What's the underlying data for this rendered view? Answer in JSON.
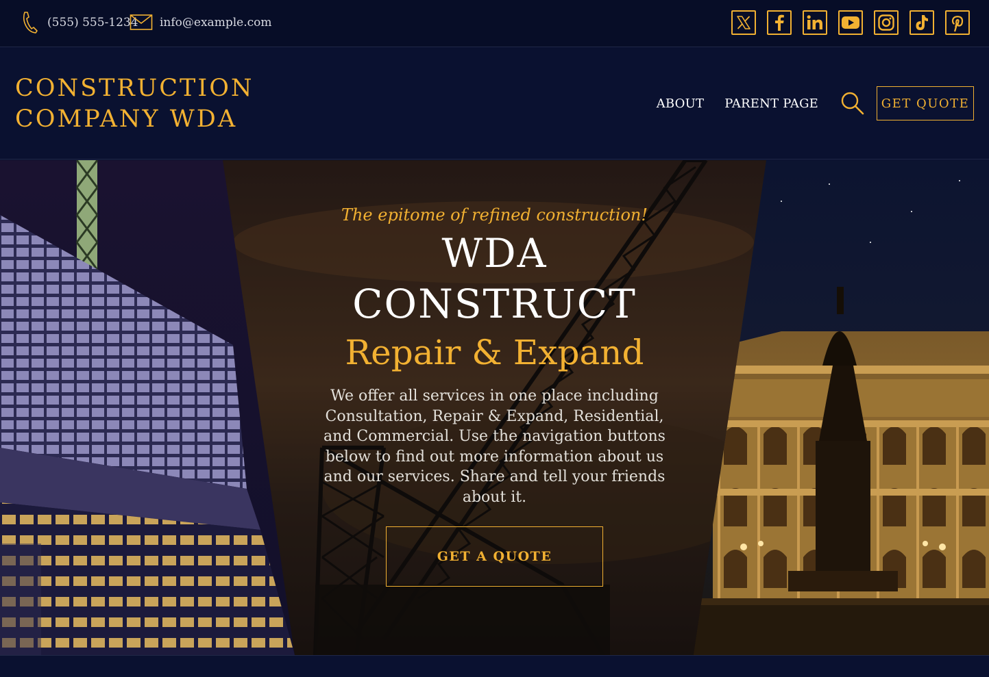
{
  "topbar": {
    "phone": "(555) 555-1234",
    "email": "info@example.com",
    "phone_icon": "phone-icon",
    "email_icon": "envelope-icon",
    "socials": [
      "x-icon",
      "facebook-icon",
      "linkedin-icon",
      "youtube-icon",
      "instagram-icon",
      "tiktok-icon",
      "pinterest-icon"
    ]
  },
  "header": {
    "brand_line1": "CONSTRUCTION",
    "brand_line2": "COMPANY WDA",
    "nav": {
      "about": "ABOUT",
      "parent_page": "PARENT PAGE",
      "search_icon": "search-icon",
      "quote": "GET QUOTE"
    }
  },
  "hero": {
    "tagline": "The epitome of refined construction!",
    "title_line1": "WDA",
    "title_line2": "CONSTRUCT",
    "subtitle": "Repair & Expand",
    "description": "We offer all services in one place including Consultation, Repair & Expand, Residential, and Commercial. Use the navigation buttons below to find out more information about us and our services. Share and tell your friends about it.",
    "cta": "GET A QUOTE"
  },
  "colors": {
    "accent": "#f2b132",
    "navy": "#0a1130",
    "topbar": "#070d27",
    "text": "#ffffff"
  }
}
